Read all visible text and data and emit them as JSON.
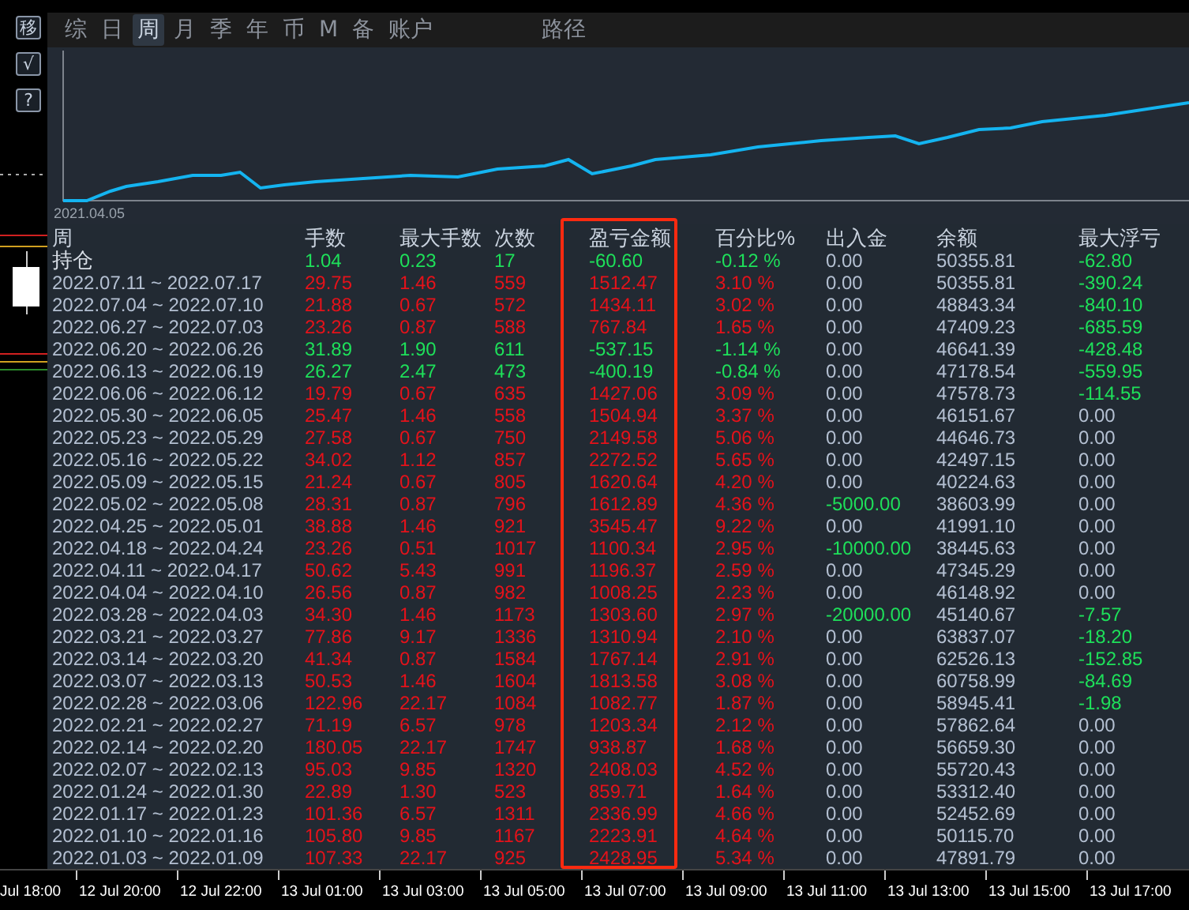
{
  "tools": [
    "移",
    "√",
    "?"
  ],
  "tabs": [
    {
      "label": "综",
      "selected": false
    },
    {
      "label": "日",
      "selected": false
    },
    {
      "label": "周",
      "selected": true
    },
    {
      "label": "月",
      "selected": false
    },
    {
      "label": "季",
      "selected": false
    },
    {
      "label": "年",
      "selected": false
    },
    {
      "label": "币",
      "selected": false
    },
    {
      "label": "M",
      "selected": false
    },
    {
      "label": "备",
      "selected": false
    },
    {
      "label": "账户",
      "selected": false
    }
  ],
  "path_button": {
    "label": "路径"
  },
  "chart": {
    "start_label": "2021.04.05"
  },
  "table": {
    "columns": [
      "周",
      "手数",
      "最大手数",
      "次数",
      "盈亏金额",
      "百分比%",
      "出入金",
      "余额",
      "最大浮亏"
    ],
    "rows": [
      {
        "period": "持仓",
        "lots": "1.04",
        "max_lots": "0.23",
        "trades": "17",
        "profit": "-60.60",
        "percent": "-0.12 %",
        "deposit": "0.00",
        "balance": "50355.81",
        "max_drawdown": "-62.80",
        "color": "#1ee05a",
        "deposit_negative": false,
        "drawdown_negative": true
      },
      {
        "period": "2022.07.11 ~ 2022.07.17",
        "lots": "29.75",
        "max_lots": "1.46",
        "trades": "559",
        "profit": "1512.47",
        "percent": "3.10 %",
        "deposit": "0.00",
        "balance": "50355.81",
        "max_drawdown": "-390.24",
        "color": "#e5121a",
        "deposit_negative": false,
        "drawdown_negative": true
      },
      {
        "period": "2022.07.04 ~ 2022.07.10",
        "lots": "21.88",
        "max_lots": "0.67",
        "trades": "572",
        "profit": "1434.11",
        "percent": "3.02 %",
        "deposit": "0.00",
        "balance": "48843.34",
        "max_drawdown": "-840.10",
        "color": "#e5121a",
        "deposit_negative": false,
        "drawdown_negative": true
      },
      {
        "period": "2022.06.27 ~ 2022.07.03",
        "lots": "23.26",
        "max_lots": "0.87",
        "trades": "588",
        "profit": "767.84",
        "percent": "1.65 %",
        "deposit": "0.00",
        "balance": "47409.23",
        "max_drawdown": "-685.59",
        "color": "#e5121a",
        "deposit_negative": false,
        "drawdown_negative": true
      },
      {
        "period": "2022.06.20 ~ 2022.06.26",
        "lots": "31.89",
        "max_lots": "1.90",
        "trades": "611",
        "profit": "-537.15",
        "percent": "-1.14 %",
        "deposit": "0.00",
        "balance": "46641.39",
        "max_drawdown": "-428.48",
        "color": "#1ee05a",
        "deposit_negative": false,
        "drawdown_negative": true
      },
      {
        "period": "2022.06.13 ~ 2022.06.19",
        "lots": "26.27",
        "max_lots": "2.47",
        "trades": "473",
        "profit": "-400.19",
        "percent": "-0.84 %",
        "deposit": "0.00",
        "balance": "47178.54",
        "max_drawdown": "-559.95",
        "color": "#1ee05a",
        "deposit_negative": false,
        "drawdown_negative": true
      },
      {
        "period": "2022.06.06 ~ 2022.06.12",
        "lots": "19.79",
        "max_lots": "0.67",
        "trades": "635",
        "profit": "1427.06",
        "percent": "3.09 %",
        "deposit": "0.00",
        "balance": "47578.73",
        "max_drawdown": "-114.55",
        "color": "#e5121a",
        "deposit_negative": false,
        "drawdown_negative": true
      },
      {
        "period": "2022.05.30 ~ 2022.06.05",
        "lots": "25.47",
        "max_lots": "1.46",
        "trades": "558",
        "profit": "1504.94",
        "percent": "3.37 %",
        "deposit": "0.00",
        "balance": "46151.67",
        "max_drawdown": "0.00",
        "color": "#e5121a",
        "deposit_negative": false,
        "drawdown_negative": false
      },
      {
        "period": "2022.05.23 ~ 2022.05.29",
        "lots": "27.58",
        "max_lots": "0.67",
        "trades": "750",
        "profit": "2149.58",
        "percent": "5.06 %",
        "deposit": "0.00",
        "balance": "44646.73",
        "max_drawdown": "0.00",
        "color": "#e5121a",
        "deposit_negative": false,
        "drawdown_negative": false
      },
      {
        "period": "2022.05.16 ~ 2022.05.22",
        "lots": "34.02",
        "max_lots": "1.12",
        "trades": "857",
        "profit": "2272.52",
        "percent": "5.65 %",
        "deposit": "0.00",
        "balance": "42497.15",
        "max_drawdown": "0.00",
        "color": "#e5121a",
        "deposit_negative": false,
        "drawdown_negative": false
      },
      {
        "period": "2022.05.09 ~ 2022.05.15",
        "lots": "21.24",
        "max_lots": "0.67",
        "trades": "805",
        "profit": "1620.64",
        "percent": "4.20 %",
        "deposit": "0.00",
        "balance": "40224.63",
        "max_drawdown": "0.00",
        "color": "#e5121a",
        "deposit_negative": false,
        "drawdown_negative": false
      },
      {
        "period": "2022.05.02 ~ 2022.05.08",
        "lots": "28.31",
        "max_lots": "0.87",
        "trades": "796",
        "profit": "1612.89",
        "percent": "4.36 %",
        "deposit": "-5000.00",
        "balance": "38603.99",
        "max_drawdown": "0.00",
        "color": "#e5121a",
        "deposit_negative": true,
        "drawdown_negative": false
      },
      {
        "period": "2022.04.25 ~ 2022.05.01",
        "lots": "38.88",
        "max_lots": "1.46",
        "trades": "921",
        "profit": "3545.47",
        "percent": "9.22 %",
        "deposit": "0.00",
        "balance": "41991.10",
        "max_drawdown": "0.00",
        "color": "#e5121a",
        "deposit_negative": false,
        "drawdown_negative": false
      },
      {
        "period": "2022.04.18 ~ 2022.04.24",
        "lots": "23.26",
        "max_lots": "0.51",
        "trades": "1017",
        "profit": "1100.34",
        "percent": "2.95 %",
        "deposit": "-10000.00",
        "balance": "38445.63",
        "max_drawdown": "0.00",
        "color": "#e5121a",
        "deposit_negative": true,
        "drawdown_negative": false
      },
      {
        "period": "2022.04.11 ~ 2022.04.17",
        "lots": "50.62",
        "max_lots": "5.43",
        "trades": "991",
        "profit": "1196.37",
        "percent": "2.59 %",
        "deposit": "0.00",
        "balance": "47345.29",
        "max_drawdown": "0.00",
        "color": "#e5121a",
        "deposit_negative": false,
        "drawdown_negative": false
      },
      {
        "period": "2022.04.04 ~ 2022.04.10",
        "lots": "26.56",
        "max_lots": "0.87",
        "trades": "982",
        "profit": "1008.25",
        "percent": "2.23 %",
        "deposit": "0.00",
        "balance": "46148.92",
        "max_drawdown": "0.00",
        "color": "#e5121a",
        "deposit_negative": false,
        "drawdown_negative": false
      },
      {
        "period": "2022.03.28 ~ 2022.04.03",
        "lots": "34.30",
        "max_lots": "1.46",
        "trades": "1173",
        "profit": "1303.60",
        "percent": "2.97 %",
        "deposit": "-20000.00",
        "balance": "45140.67",
        "max_drawdown": "-7.57",
        "color": "#e5121a",
        "deposit_negative": true,
        "drawdown_negative": true
      },
      {
        "period": "2022.03.21 ~ 2022.03.27",
        "lots": "77.86",
        "max_lots": "9.17",
        "trades": "1336",
        "profit": "1310.94",
        "percent": "2.10 %",
        "deposit": "0.00",
        "balance": "63837.07",
        "max_drawdown": "-18.20",
        "color": "#e5121a",
        "deposit_negative": false,
        "drawdown_negative": true
      },
      {
        "period": "2022.03.14 ~ 2022.03.20",
        "lots": "41.34",
        "max_lots": "0.87",
        "trades": "1584",
        "profit": "1767.14",
        "percent": "2.91 %",
        "deposit": "0.00",
        "balance": "62526.13",
        "max_drawdown": "-152.85",
        "color": "#e5121a",
        "deposit_negative": false,
        "drawdown_negative": true
      },
      {
        "period": "2022.03.07 ~ 2022.03.13",
        "lots": "50.53",
        "max_lots": "1.46",
        "trades": "1604",
        "profit": "1813.58",
        "percent": "3.08 %",
        "deposit": "0.00",
        "balance": "60758.99",
        "max_drawdown": "-84.69",
        "color": "#e5121a",
        "deposit_negative": false,
        "drawdown_negative": true
      },
      {
        "period": "2022.02.28 ~ 2022.03.06",
        "lots": "122.96",
        "max_lots": "22.17",
        "trades": "1084",
        "profit": "1082.77",
        "percent": "1.87 %",
        "deposit": "0.00",
        "balance": "58945.41",
        "max_drawdown": "-1.98",
        "color": "#e5121a",
        "deposit_negative": false,
        "drawdown_negative": true
      },
      {
        "period": "2022.02.21 ~ 2022.02.27",
        "lots": "71.19",
        "max_lots": "6.57",
        "trades": "978",
        "profit": "1203.34",
        "percent": "2.12 %",
        "deposit": "0.00",
        "balance": "57862.64",
        "max_drawdown": "0.00",
        "color": "#e5121a",
        "deposit_negative": false,
        "drawdown_negative": false
      },
      {
        "period": "2022.02.14 ~ 2022.02.20",
        "lots": "180.05",
        "max_lots": "22.17",
        "trades": "1747",
        "profit": "938.87",
        "percent": "1.68 %",
        "deposit": "0.00",
        "balance": "56659.30",
        "max_drawdown": "0.00",
        "color": "#e5121a",
        "deposit_negative": false,
        "drawdown_negative": false
      },
      {
        "period": "2022.02.07 ~ 2022.02.13",
        "lots": "95.03",
        "max_lots": "9.85",
        "trades": "1320",
        "profit": "2408.03",
        "percent": "4.52 %",
        "deposit": "0.00",
        "balance": "55720.43",
        "max_drawdown": "0.00",
        "color": "#e5121a",
        "deposit_negative": false,
        "drawdown_negative": false
      },
      {
        "period": "2022.01.24 ~ 2022.01.30",
        "lots": "22.89",
        "max_lots": "1.30",
        "trades": "523",
        "profit": "859.71",
        "percent": "1.64 %",
        "deposit": "0.00",
        "balance": "53312.40",
        "max_drawdown": "0.00",
        "color": "#e5121a",
        "deposit_negative": false,
        "drawdown_negative": false
      },
      {
        "period": "2022.01.17 ~ 2022.01.23",
        "lots": "101.36",
        "max_lots": "6.57",
        "trades": "1311",
        "profit": "2336.99",
        "percent": "4.66 %",
        "deposit": "0.00",
        "balance": "52452.69",
        "max_drawdown": "0.00",
        "color": "#e5121a",
        "deposit_negative": false,
        "drawdown_negative": false
      },
      {
        "period": "2022.01.10 ~ 2022.01.16",
        "lots": "105.80",
        "max_lots": "9.85",
        "trades": "1167",
        "profit": "2223.91",
        "percent": "4.64 %",
        "deposit": "0.00",
        "balance": "50115.70",
        "max_drawdown": "0.00",
        "color": "#e5121a",
        "deposit_negative": false,
        "drawdown_negative": false
      },
      {
        "period": "2022.01.03 ~ 2022.01.09",
        "lots": "107.33",
        "max_lots": "22.17",
        "trades": "925",
        "profit": "2428.95",
        "percent": "5.34 %",
        "deposit": "0.00",
        "balance": "47891.79",
        "max_drawdown": "0.00",
        "color": "#e5121a",
        "deposit_negative": false,
        "drawdown_negative": false
      }
    ]
  },
  "time_axis": [
    "Jul 18:00",
    "12 Jul 20:00",
    "12 Jul 22:00",
    "13 Jul 01:00",
    "13 Jul 03:00",
    "13 Jul 05:00",
    "13 Jul 07:00",
    "13 Jul 09:00",
    "13 Jul 11:00",
    "13 Jul 13:00",
    "13 Jul 15:00",
    "13 Jul 17:00"
  ]
}
